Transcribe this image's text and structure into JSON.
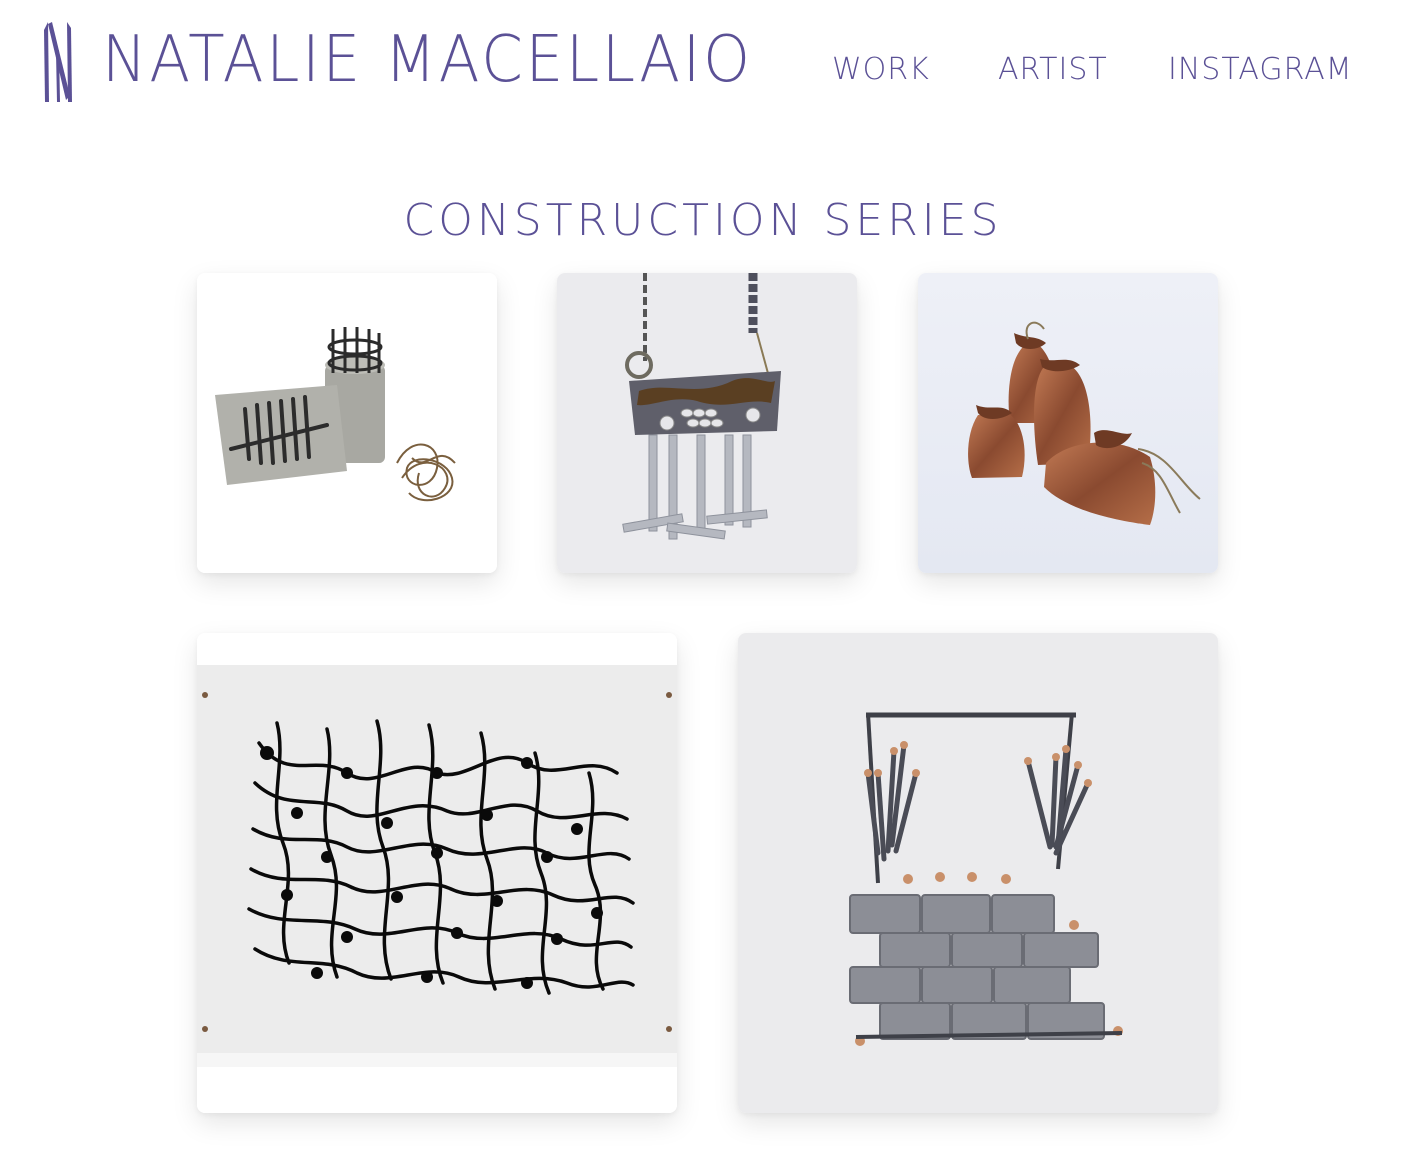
{
  "header": {
    "site_title": "NATALIE MACELLAIO",
    "logo_icon": "nm-monogram-icon",
    "nav": [
      {
        "label": "WORK"
      },
      {
        "label": "ARTIST"
      },
      {
        "label": "INSTAGRAM"
      }
    ]
  },
  "main": {
    "title": "CONSTRUCTION SERIES",
    "gallery": [
      {
        "subject": "concrete-blocks-with-nails-and-wire"
      },
      {
        "subject": "concrete-pendant-necklace"
      },
      {
        "subject": "copper-sacks"
      },
      {
        "subject": "ink-net-drawing"
      },
      {
        "subject": "brick-wall-necklace"
      }
    ]
  },
  "colors": {
    "brand_purple": "#5b5196",
    "background": "#ffffff"
  }
}
